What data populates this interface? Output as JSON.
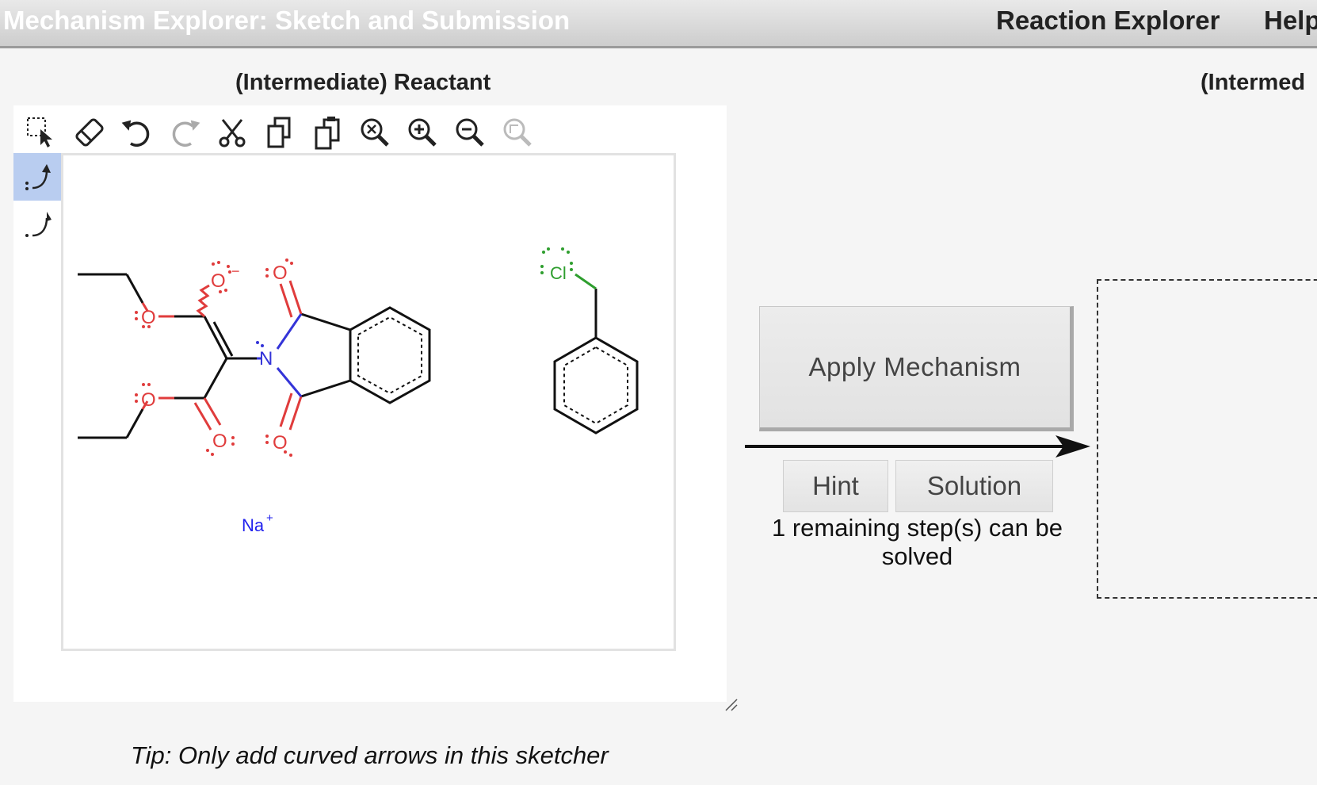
{
  "header": {
    "title": "Mechanism Explorer: Sketch and Submission",
    "nav": [
      "Reaction Explorer",
      "Help"
    ]
  },
  "reactant_panel": {
    "heading": "(Intermediate) Reactant",
    "tip": "Tip: Only add curved arrows in this sketcher",
    "toolbar": [
      "select-icon",
      "eraser-icon",
      "undo-icon",
      "redo-icon",
      "cut-icon",
      "copy-icon",
      "paste-icon",
      "zoom-fit-icon",
      "zoom-in-icon",
      "zoom-out-icon",
      "zoom-reset-icon"
    ],
    "side_tools": [
      "electron-pair-arrow-icon",
      "single-electron-arrow-icon"
    ],
    "molecule": {
      "atom_labels": {
        "o_anion": "O",
        "o_anion_charge": "−",
        "o_ester_top": "O",
        "o_ester_bottom": "O",
        "o_carbonyl_bottom": "O",
        "o_imide_top": "O",
        "o_imide_bottom": "O",
        "n": "N",
        "cl": "Cl",
        "na": "Na",
        "na_charge": "+"
      }
    }
  },
  "center": {
    "apply_label": "Apply Mechanism",
    "hint_label": "Hint",
    "solution_label": "Solution",
    "status": "1 remaining step(s) can be solved"
  },
  "product_panel": {
    "heading": "(Intermed"
  },
  "colors": {
    "oxygen": "#e03c3c",
    "nitrogen": "#3434d8",
    "chlorine": "#2e9e2e",
    "sodium": "#2222ee",
    "active_tool": "#b9cdf0"
  }
}
